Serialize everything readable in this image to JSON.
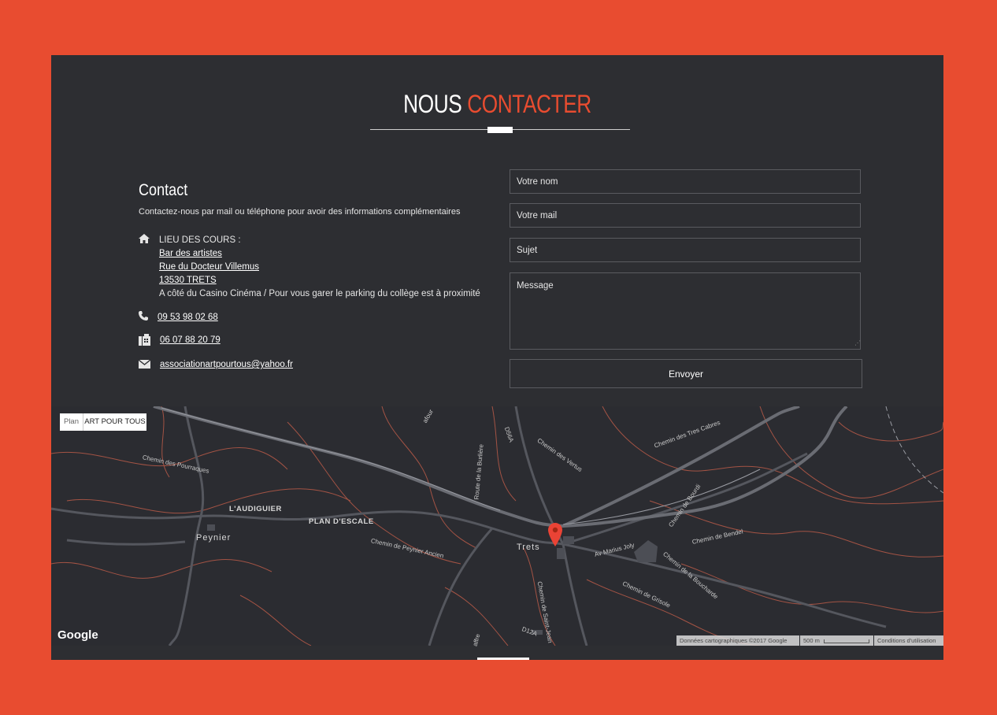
{
  "heading": {
    "part1": "NOUS",
    "part2": "CONTACTER"
  },
  "contact": {
    "title": "Contact",
    "description": "Contactez-nous par mail ou téléphone pour avoir des informations complémentaires",
    "location_label": "LIEU DES COURS :",
    "location_lines": [
      "Bar des artistes",
      "Rue du Docteur Villemus",
      "13530 TRETS"
    ],
    "location_note": "A côté du Casino Cinéma / Pour vous garer le parking du collège est à proximité",
    "phone": "09 53 98 02 68",
    "mobile": "06 07 88 20 79",
    "email": "associationartpourtous@yahoo.fr"
  },
  "form": {
    "name_placeholder": "Votre nom",
    "email_placeholder": "Votre mail",
    "subject_placeholder": "Sujet",
    "message_placeholder": "Message",
    "submit_label": "Envoyer"
  },
  "map": {
    "tab_plan": "Plan",
    "tab_name": "ART POUR TOUS",
    "places": [
      "L'AUDIGUIER",
      "PLAN D'ESCALE",
      "Peynier",
      "Trets"
    ],
    "roads": [
      "Chemin des Pourraques",
      "Route de la Burlière",
      "D56A",
      "Chemin des Vertus",
      "Chemin des Tres Cabres",
      "Chemin de Bourdi",
      "Chemin de Bendel",
      "Av Marius Joly",
      "Chemin de Peynier Ancien",
      "Chemin de la Boucharde",
      "Chemin de Grisole",
      "Chemin de Saint-Jean",
      "D12A",
      "affre",
      "afour"
    ],
    "logo": "Google",
    "attribution": "Données cartographiques ©2017 Google",
    "scale": "500 m",
    "terms": "Conditions d'utilisation"
  },
  "colors": {
    "accent": "#e84c30",
    "panel": "#2d2e32",
    "map_bg": "#2b2c31"
  }
}
